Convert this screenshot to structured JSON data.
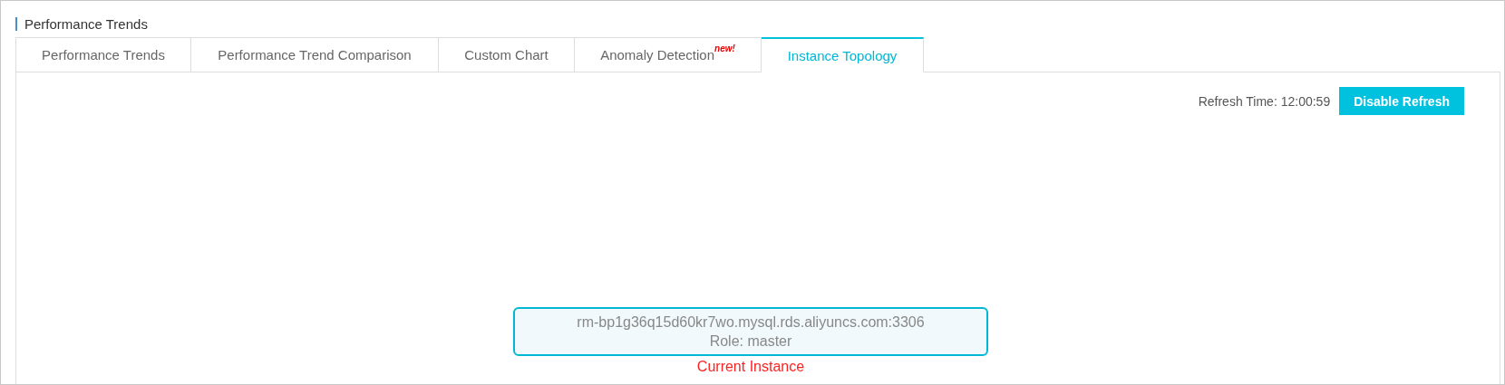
{
  "section_title": "Performance Trends",
  "tabs": [
    {
      "label": "Performance Trends",
      "selected": false
    },
    {
      "label": "Performance Trend Comparison",
      "selected": false
    },
    {
      "label": "Custom Chart",
      "selected": false
    },
    {
      "label": "Anomaly Detection",
      "badge": "new!",
      "selected": false
    },
    {
      "label": "Instance Topology",
      "selected": true
    }
  ],
  "refresh_time": "Refresh Time: 12:00:59",
  "refresh_button": "Disable Refresh",
  "topology": {
    "node": {
      "host": "rm-bp1g36q15d60kr7wo.mysql.rds.aliyuncs.com:3306",
      "role": "Role: master",
      "caption": "Current Instance"
    }
  }
}
